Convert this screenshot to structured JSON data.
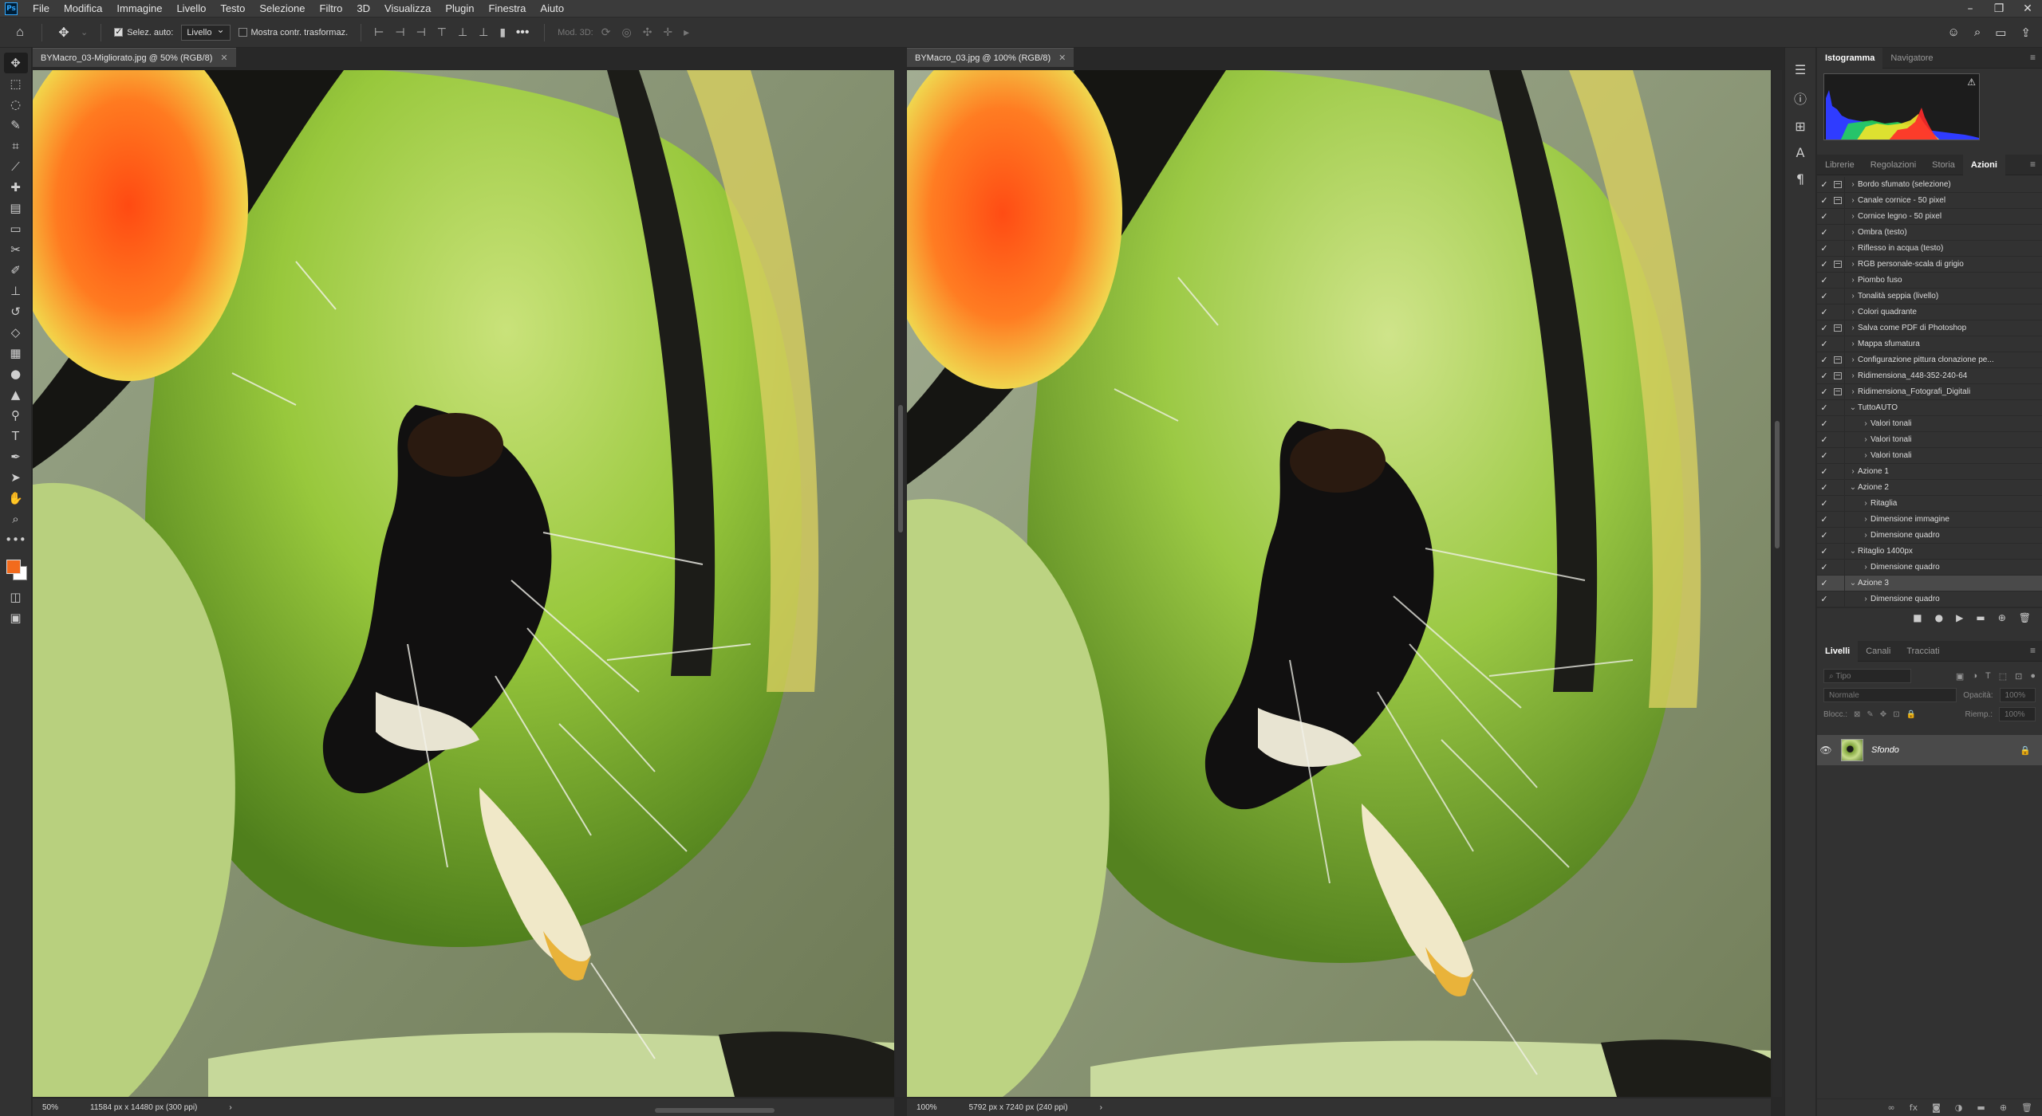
{
  "menu": {
    "items": [
      "File",
      "Modifica",
      "Immagine",
      "Livello",
      "Testo",
      "Selezione",
      "Filtro",
      "3D",
      "Visualizza",
      "Plugin",
      "Finestra",
      "Aiuto"
    ],
    "logo": "Ps"
  },
  "options": {
    "auto_select_label": "Selez. auto:",
    "layer_select_value": "Livello",
    "show_transform_label": "Mostra contr. trasformaz.",
    "mode_3d_label": "Mod. 3D:"
  },
  "documents": {
    "left": {
      "tab_title": "BYMacro_03-Migliorato.jpg @ 50% (RGB/8)",
      "zoom": "50%",
      "size_info": "11584 px x 14480 px (300 ppi)"
    },
    "right": {
      "tab_title": "BYMacro_03.jpg @ 100% (RGB/8)",
      "zoom": "100%",
      "size_info": "5792 px x 7240 px (240 ppi)"
    }
  },
  "panels": {
    "top_tabs": [
      "Istogramma",
      "Navigatore"
    ],
    "mid_tabs": [
      "Librerie",
      "Regolazioni",
      "Storia",
      "Azioni"
    ],
    "actions": [
      {
        "label": "Bordo sfumato (selezione)",
        "indent": 0,
        "dialog": true
      },
      {
        "label": "Canale cornice - 50 pixel",
        "indent": 0,
        "dialog": true
      },
      {
        "label": "Cornice legno - 50 pixel",
        "indent": 0,
        "dialog": false
      },
      {
        "label": "Ombra (testo)",
        "indent": 0,
        "dialog": false
      },
      {
        "label": "Riflesso in acqua (testo)",
        "indent": 0,
        "dialog": false
      },
      {
        "label": "RGB personale-scala di grigio",
        "indent": 0,
        "dialog": true
      },
      {
        "label": "Piombo fuso",
        "indent": 0,
        "dialog": false
      },
      {
        "label": "Tonalità seppia (livello)",
        "indent": 0,
        "dialog": false
      },
      {
        "label": "Colori quadrante",
        "indent": 0,
        "dialog": false
      },
      {
        "label": "Salva come PDF di Photoshop",
        "indent": 0,
        "dialog": true
      },
      {
        "label": "Mappa sfumatura",
        "indent": 0,
        "dialog": false
      },
      {
        "label": "Configurazione pittura clonazione pe...",
        "indent": 0,
        "dialog": true
      },
      {
        "label": "Ridimensiona_448-352-240-64",
        "indent": 0,
        "dialog": true
      },
      {
        "label": "Ridimensiona_Fotografi_Digitali",
        "indent": 0,
        "dialog": true
      },
      {
        "label": "TuttoAUTO",
        "indent": 0,
        "dialog": false,
        "open": true
      },
      {
        "label": "Valori tonali",
        "indent": 1,
        "dialog": false
      },
      {
        "label": "Valori tonali",
        "indent": 1,
        "dialog": false
      },
      {
        "label": "Valori tonali",
        "indent": 1,
        "dialog": false
      },
      {
        "label": "Azione 1",
        "indent": 0,
        "dialog": false
      },
      {
        "label": "Azione 2",
        "indent": 0,
        "dialog": false,
        "open": true
      },
      {
        "label": "Ritaglia",
        "indent": 1,
        "dialog": false
      },
      {
        "label": "Dimensione immagine",
        "indent": 1,
        "dialog": false
      },
      {
        "label": "Dimensione quadro",
        "indent": 1,
        "dialog": false
      },
      {
        "label": "Ritaglio 1400px",
        "indent": 0,
        "dialog": false,
        "open": true
      },
      {
        "label": "Dimensione quadro",
        "indent": 1,
        "dialog": false
      },
      {
        "label": "Azione 3",
        "indent": 0,
        "dialog": false,
        "open": true,
        "selected": true
      },
      {
        "label": "Dimensione quadro",
        "indent": 1,
        "dialog": false
      }
    ],
    "bottom_tabs": [
      "Livelli",
      "Canali",
      "Tracciati"
    ],
    "layers": {
      "filter_placeholder": "Tipo",
      "blend_mode": "Normale",
      "opacity_label": "Opacità:",
      "opacity_value": "100%",
      "lock_label": "Blocc.:",
      "fill_label": "Riemp.:",
      "fill_value": "100%",
      "layer_name": "Sfondo"
    }
  },
  "colors": {
    "foreground": "#f26b1d",
    "background": "#ffffff",
    "accent": "#31a8ff"
  }
}
